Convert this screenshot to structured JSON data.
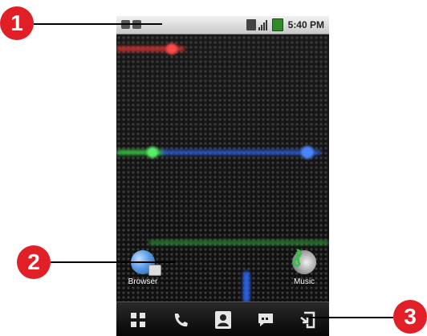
{
  "status_bar": {
    "time": "5:40 PM",
    "icons": [
      "sync-icon",
      "signal-bars-icon",
      "battery-icon"
    ]
  },
  "home": {
    "apps": [
      {
        "label": "Browser",
        "icon": "browser-icon"
      },
      {
        "label": "Music",
        "icon": "music-icon"
      }
    ]
  },
  "dock": {
    "items": [
      "apps-grid-icon",
      "phone-icon",
      "contacts-icon",
      "messaging-icon",
      "exit-icon"
    ]
  },
  "callouts": [
    "1",
    "2",
    "3"
  ],
  "colors": {
    "callout": "#e01f26",
    "streak_red": "#e63a3a",
    "streak_green": "#3bd24a",
    "streak_blue": "#2e6cf5"
  }
}
